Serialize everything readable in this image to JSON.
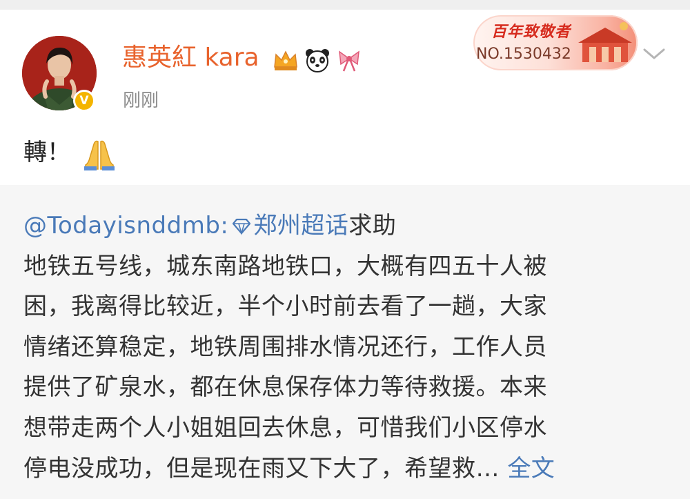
{
  "post": {
    "username": "惠英紅 kara",
    "time": "刚刚",
    "verified_mark": "V",
    "text": "轉！",
    "badges": [
      "crown-badge-icon",
      "panda-badge-icon",
      "bow-badge-icon"
    ],
    "emoji": "folded-hands-emoji"
  },
  "anniversary_badge": {
    "title": "百年致敬者",
    "number": "NO.1530432"
  },
  "quote": {
    "mention": "@Todayisnddmb:",
    "topic": "郑州超话",
    "lines": [
      "求助",
      "地铁五号线，城东南路地铁口，大概有四五十人被",
      "困，我离得比较近，半个小时前去看了一趟，大家",
      "情绪还算稳定，地铁周围排水情况还行，工作人员",
      "提供了矿泉水，都在休息保存体力等待救援。本来",
      "想带走两个人小姐姐回去休息，可惜我们小区停水",
      "停电没成功，但是现在雨又下大了，希望救… "
    ],
    "more_link": "全文"
  },
  "colors": {
    "username": "#e8632d",
    "link": "#4a7ab8",
    "quote_bg": "#f6f6f6",
    "time": "#8b8b8b"
  }
}
